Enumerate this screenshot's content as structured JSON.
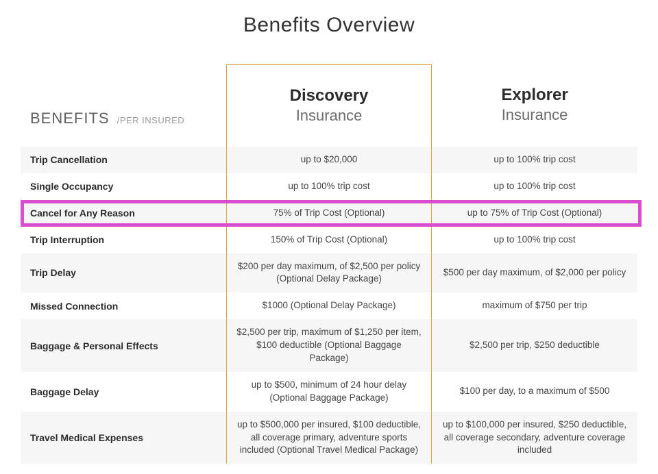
{
  "title": "Benefits Overview",
  "header": {
    "benefits_label": "BENEFITS",
    "benefits_sub": "/PER INSURED",
    "plans": [
      {
        "name": "Discovery",
        "sub": "Insurance"
      },
      {
        "name": "Explorer",
        "sub": "Insurance"
      }
    ]
  },
  "rows": [
    {
      "label": "Trip Cancellation",
      "discovery": "up to $20,000",
      "explorer": "up to 100% trip cost"
    },
    {
      "label": "Single Occupancy",
      "discovery": "up to 100% trip cost",
      "explorer": "up to 100% trip cost"
    },
    {
      "label": "Cancel for Any Reason",
      "discovery": "75% of Trip Cost (Optional)",
      "explorer": "up to 75% of Trip Cost (Optional)",
      "highlighted": true
    },
    {
      "label": "Trip Interruption",
      "discovery": "150% of Trip Cost (Optional)",
      "explorer": "up to 100% trip cost"
    },
    {
      "label": "Trip Delay",
      "discovery": "$200 per day maximum, of $2,500 per policy (Optional Delay Package)",
      "explorer": "$500 per day maximum, of $2,000 per policy"
    },
    {
      "label": "Missed Connection",
      "discovery": "$1000 (Optional Delay Package)",
      "explorer": "maximum of $750 per trip"
    },
    {
      "label": "Baggage & Personal Effects",
      "discovery": "$2,500 per trip, maximum of $1,250 per item, $100 deductible (Optional Baggage Package)",
      "explorer": "$2,500 per trip, $250 deductible"
    },
    {
      "label": "Baggage Delay",
      "discovery": "up to $500, minimum of 24 hour delay (Optional Baggage Package)",
      "explorer": "$100 per day, to a maximum of $500"
    },
    {
      "label": "Travel Medical Expenses",
      "discovery": "up to $500,000 per insured, $100 deductible, all coverage primary, adventure sports included (Optional Travel Medical Package)",
      "explorer": "up to $100,000 per insured, $250 deductible, all coverage secondary, adventure coverage included"
    }
  ]
}
